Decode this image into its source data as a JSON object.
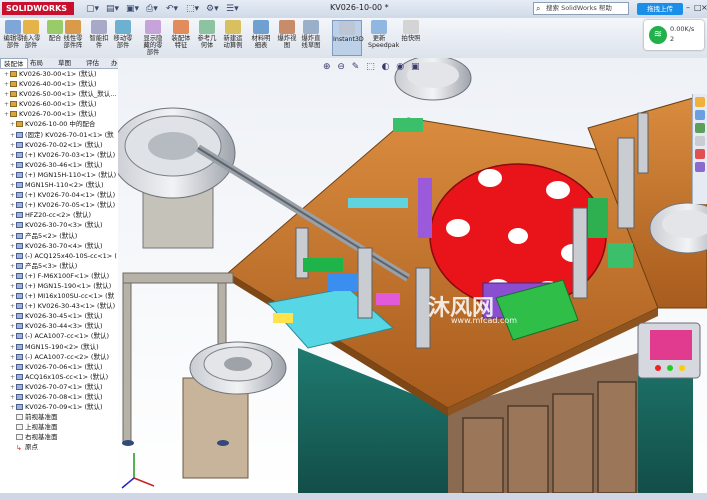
{
  "titlebar": {
    "logo": "SOLIDWORKS",
    "doc_title": "KV026-10-00 *",
    "search_placeholder": "搜索 SolidWorks 帮助",
    "upload_button": "拖拽上传",
    "min": "–",
    "max": "□",
    "close": "×"
  },
  "ribbon": {
    "buttons": [
      {
        "label": "编辑零\n部件"
      },
      {
        "label": "插入零\n部件"
      },
      {
        "label": "配合"
      },
      {
        "label": "线性零\n部件阵"
      },
      {
        "label": "智能扣\n件"
      },
      {
        "label": "移动零\n部件"
      },
      {
        "label": "显示隐\n藏的零\n部件"
      },
      {
        "label": "装配体\n特征"
      },
      {
        "label": "参考几\n何体"
      },
      {
        "label": "新建运\n动算例"
      },
      {
        "label": "材料明\n细表"
      },
      {
        "label": "爆炸视\n图"
      },
      {
        "label": "爆炸直\n线草图"
      },
      {
        "label": "Instant3D"
      },
      {
        "label": "更新\nSpeedpak"
      },
      {
        "label": "拍快照"
      }
    ]
  },
  "speed": {
    "up": "0.00K/s",
    "down": "2"
  },
  "tabs": [
    "装配体",
    "布局",
    "草图",
    "评估",
    "办公室产品"
  ],
  "tree": [
    {
      "text": "KV026-30-00<1> (默认)",
      "type": "asm"
    },
    {
      "text": "KV026-40-00<1> (默认)",
      "type": "asm"
    },
    {
      "text": "KV026-50-00<1> (默认_默认...",
      "type": "asm"
    },
    {
      "text": "KV026-60-00<1> (默认)",
      "type": "asm"
    },
    {
      "text": "KV026-70-00<1> (默认)",
      "type": "asm"
    },
    {
      "text": "KV026-10-00 中的配合",
      "type": "asm"
    },
    {
      "text": "(固定) KV026-70-01<1> (默",
      "type": "part"
    },
    {
      "text": "KV026-70-02<1> (默认)",
      "type": "part"
    },
    {
      "text": "(+) KV026-70-03<1> (默认)",
      "type": "part"
    },
    {
      "text": "KV026-30-46<1> (默认)",
      "type": "part"
    },
    {
      "text": "(+) MGN15H-110<1> (默认)",
      "type": "part"
    },
    {
      "text": "MGN15H-110<2> (默认)",
      "type": "part"
    },
    {
      "text": "(+) KV026-70-04<1> (默认)",
      "type": "part"
    },
    {
      "text": "(+) KV026-70-05<1> (默认)",
      "type": "part"
    },
    {
      "text": "HFZ20-cc<2> (默认)",
      "type": "part"
    },
    {
      "text": "KV026-30-70<3> (默认)",
      "type": "part"
    },
    {
      "text": "产品5<2> (默认)",
      "type": "part"
    },
    {
      "text": "KV026-30-70<4> (默认)",
      "type": "part"
    },
    {
      "text": "(-) ACQ125x40-10S-cc<1> (",
      "type": "part"
    },
    {
      "text": "产品5<3> (默认)",
      "type": "part"
    },
    {
      "text": "(+) F-M6X100F<1> (默认)",
      "type": "part"
    },
    {
      "text": "(+) MGN15-190<1> (默认)",
      "type": "part"
    },
    {
      "text": "(+) MI16x100SU-cc<1> (默",
      "type": "part"
    },
    {
      "text": "(+) KV026-30-43<1> (默认)",
      "type": "part"
    },
    {
      "text": "KV026-30-45<1> (默认)",
      "type": "part"
    },
    {
      "text": "KV026-30-44<3> (默认)",
      "type": "part"
    },
    {
      "text": "(-) ACA1007-cc<1> (默认)",
      "type": "part"
    },
    {
      "text": "MGN15-190<2> (默认)",
      "type": "part"
    },
    {
      "text": "(-) ACA1007-cc<2> (默认)",
      "type": "part"
    },
    {
      "text": "KV026-70-06<1> (默认)",
      "type": "part"
    },
    {
      "text": "ACQ16x10S-cc<1> (默认)",
      "type": "part"
    },
    {
      "text": "KV026-70-07<1> (默认)",
      "type": "part"
    },
    {
      "text": "KV026-70-08<1> (默认)",
      "type": "part"
    },
    {
      "text": "KV026-70-09<1> (默认)",
      "type": "part"
    },
    {
      "text": "前视基准面",
      "type": "plane"
    },
    {
      "text": "上视基准面",
      "type": "plane"
    },
    {
      "text": "右视基准面",
      "type": "plane"
    },
    {
      "text": "原点",
      "type": "origin"
    }
  ],
  "viewport": {
    "toolbar": "⊕ ⊖ ✎ ⬚ ◐ ◉ ▣",
    "watermark": "沐风网",
    "watermark_url": "www.mfcad.com"
  },
  "colors": {
    "accent": "#1b8fe8",
    "logo": "#c8102e",
    "turntable": "#e8141a",
    "frame": "#c8742c",
    "cabinet": "#1a6b63"
  }
}
